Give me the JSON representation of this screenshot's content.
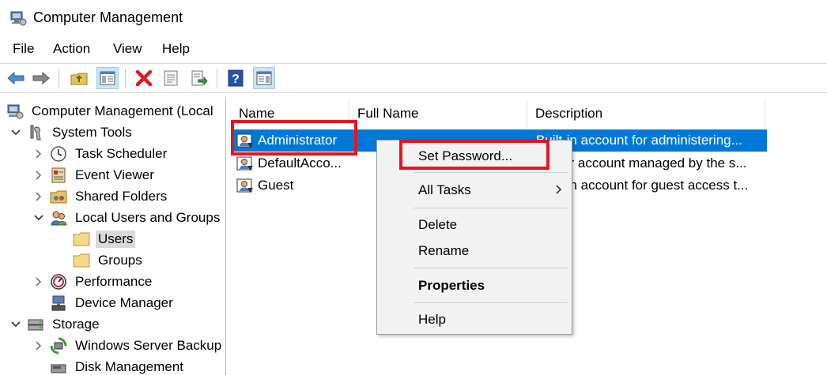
{
  "window": {
    "title": "Computer Management"
  },
  "menu": [
    "File",
    "Action",
    "View",
    "Help"
  ],
  "toolbar": {
    "buttons": [
      "back-arrow-icon",
      "forward-arrow-icon",
      "up-folder-icon",
      "show-hide-tree-icon",
      "delete-icon",
      "properties-icon",
      "export-list-icon",
      "help-icon",
      "show-hide-action-pane-icon"
    ]
  },
  "tree": {
    "items": [
      {
        "label": "Computer Management (Local"
      },
      {
        "label": "System Tools"
      },
      {
        "label": "Task Scheduler"
      },
      {
        "label": "Event Viewer"
      },
      {
        "label": "Shared Folders"
      },
      {
        "label": "Local Users and Groups"
      },
      {
        "label": "Users"
      },
      {
        "label": "Groups"
      },
      {
        "label": "Performance"
      },
      {
        "label": "Device Manager"
      },
      {
        "label": "Storage"
      },
      {
        "label": "Windows Server Backup"
      },
      {
        "label": "Disk Management"
      }
    ]
  },
  "list": {
    "columns": [
      "Name",
      "Full Name",
      "Description"
    ],
    "rows": [
      {
        "name": "Administrator",
        "full_name": "",
        "description": "Built-in account for administering..."
      },
      {
        "name": "DefaultAcco...",
        "full_name": "",
        "description": "A user account managed by the s..."
      },
      {
        "name": "Guest",
        "full_name": "",
        "description": "Built-in account for guest access t..."
      }
    ]
  },
  "context_menu": {
    "items": [
      "Set Password...",
      "All Tasks",
      "Delete",
      "Rename",
      "Properties",
      "Help"
    ]
  },
  "colors": {
    "selection": "#0078d7",
    "highlight": "#e8141c",
    "menu_bg": "#f2f2f2"
  }
}
